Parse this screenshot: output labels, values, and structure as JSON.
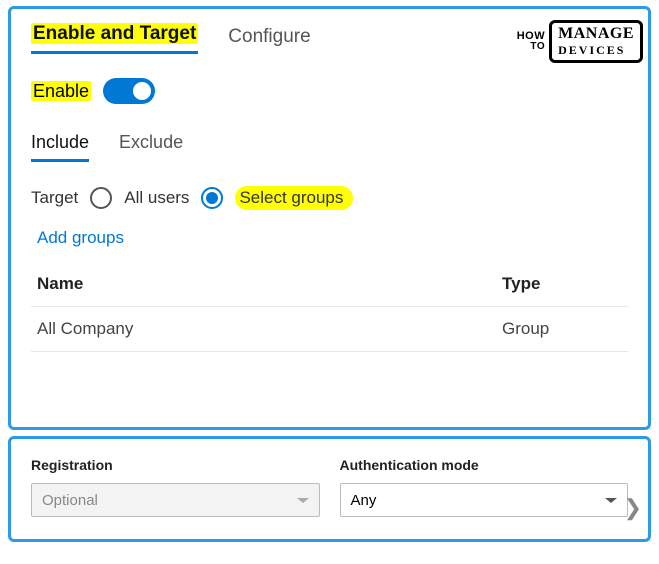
{
  "logo": {
    "how": "HOW",
    "to": "TO",
    "main": "MANAGE",
    "sub": "DEVICES"
  },
  "main_tabs": {
    "enable_target": "Enable and Target",
    "configure": "Configure"
  },
  "enable": {
    "label": "Enable",
    "on": true
  },
  "sub_tabs": {
    "include": "Include",
    "exclude": "Exclude"
  },
  "target": {
    "label": "Target",
    "all_users": "All users",
    "select_groups": "Select groups",
    "selected": "select_groups"
  },
  "add_groups": "Add groups",
  "table": {
    "headers": {
      "name": "Name",
      "type": "Type"
    },
    "rows": [
      {
        "name": "All Company",
        "type": "Group"
      }
    ]
  },
  "bottom": {
    "registration": {
      "label": "Registration",
      "value": "Optional",
      "disabled": true
    },
    "auth_mode": {
      "label": "Authentication mode",
      "value": "Any",
      "disabled": false
    }
  }
}
